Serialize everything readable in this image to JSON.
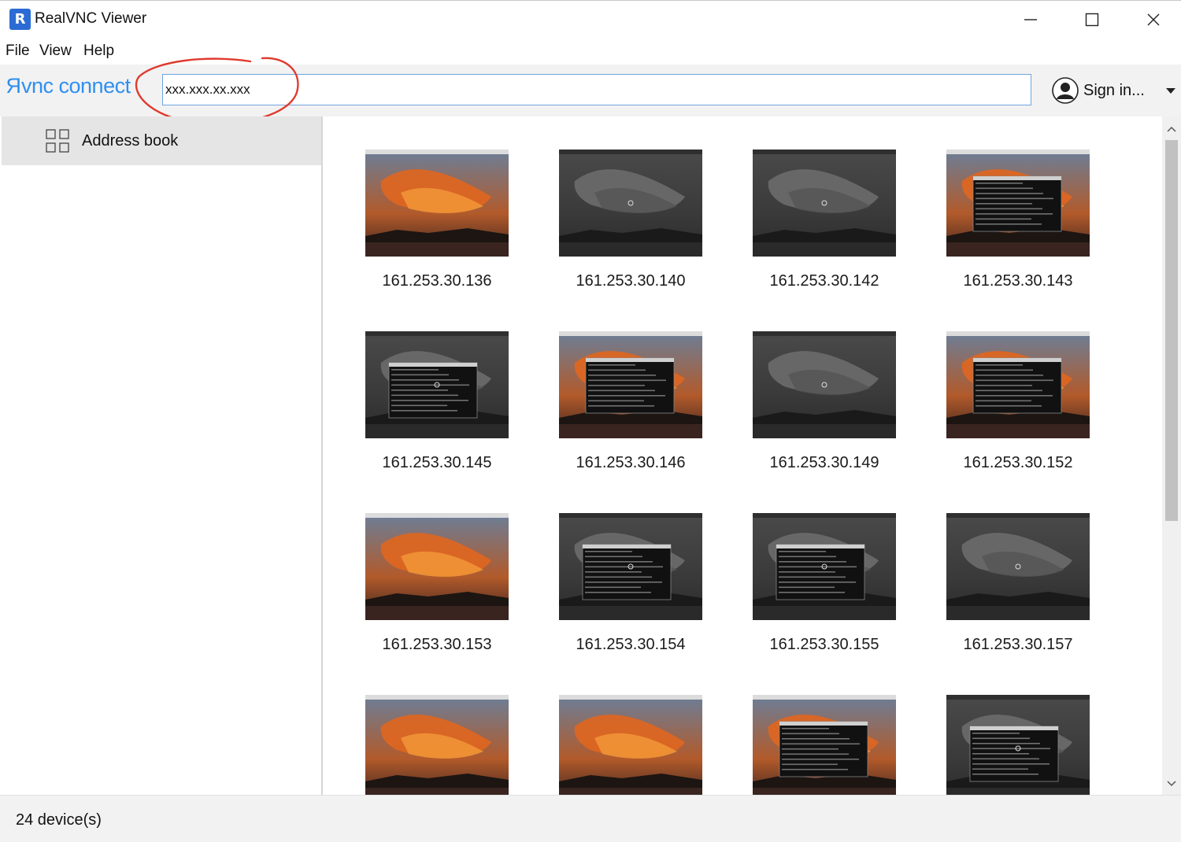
{
  "window": {
    "title": "RealVNC Viewer",
    "icon": "realvnc-app-icon",
    "icon_text": "R"
  },
  "menu": {
    "items": [
      "File",
      "View",
      "Help"
    ]
  },
  "toolbar": {
    "brand": "vnc connect",
    "brand_prefix": "R",
    "address_value": "xxx.xxx.xx.xxx",
    "signin_label": "Sign in..."
  },
  "sidebar": {
    "items": [
      {
        "label": "Address book",
        "icon": "grid-icon",
        "selected": true
      }
    ]
  },
  "devices": [
    {
      "label": "161.253.30.136",
      "theme": "color"
    },
    {
      "label": "161.253.30.140",
      "theme": "gray"
    },
    {
      "label": "161.253.30.142",
      "theme": "gray"
    },
    {
      "label": "161.253.30.143",
      "theme": "color-terminal"
    },
    {
      "label": "161.253.30.145",
      "theme": "gray-terminal"
    },
    {
      "label": "161.253.30.146",
      "theme": "color-terminal"
    },
    {
      "label": "161.253.30.149",
      "theme": "gray"
    },
    {
      "label": "161.253.30.152",
      "theme": "color-terminal"
    },
    {
      "label": "161.253.30.153",
      "theme": "color"
    },
    {
      "label": "161.253.30.154",
      "theme": "gray-terminal"
    },
    {
      "label": "161.253.30.155",
      "theme": "gray-terminal"
    },
    {
      "label": "161.253.30.157",
      "theme": "gray"
    },
    {
      "label": "",
      "theme": "color"
    },
    {
      "label": "",
      "theme": "color"
    },
    {
      "label": "",
      "theme": "color-terminal"
    },
    {
      "label": "",
      "theme": "gray-terminal"
    }
  ],
  "status": {
    "text": "24 device(s)"
  },
  "colors": {
    "accent": "#2e8ff0",
    "annotation": "#e03a2f",
    "sky_orange": "#e0661f",
    "sky_dark": "#2a1e1a"
  }
}
